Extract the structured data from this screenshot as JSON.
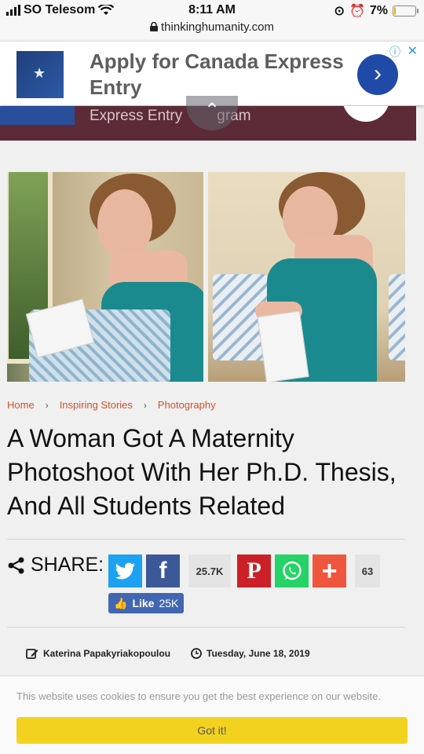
{
  "status_bar": {
    "carrier": "SO Telesom",
    "time": "8:11 AM",
    "battery": "7%",
    "battery_level": 0.07
  },
  "url_bar": {
    "domain": "thinkinghumanity.com"
  },
  "ad": {
    "title": "Apply for Canada Express Entry",
    "behind_text": "Express Entry",
    "behind_text_tail": "gram"
  },
  "breadcrumb": {
    "home": "Home",
    "category": "Inspiring Stories",
    "subcategory": "Photography"
  },
  "article": {
    "title": "A Woman Got A Maternity Photoshoot With Her Ph.D. Thesis, And All Students Related"
  },
  "share": {
    "label": "SHARE:",
    "facebook_count": "25.7K",
    "total_count": "63",
    "like_label": "Like",
    "like_count": "25K"
  },
  "meta": {
    "author": "Katerina Papakyriakopoulou",
    "date": "Tuesday, June 18, 2019"
  },
  "cookie": {
    "message": "This website uses cookies to ensure you get the best experience on our website.",
    "button": "Got it!"
  },
  "colors": {
    "accent": "#d0522a",
    "twitter": "#1da1f2",
    "facebook": "#3b5998",
    "pinterest": "#cb2027",
    "whatsapp": "#25d366",
    "more": "#f0563e"
  }
}
